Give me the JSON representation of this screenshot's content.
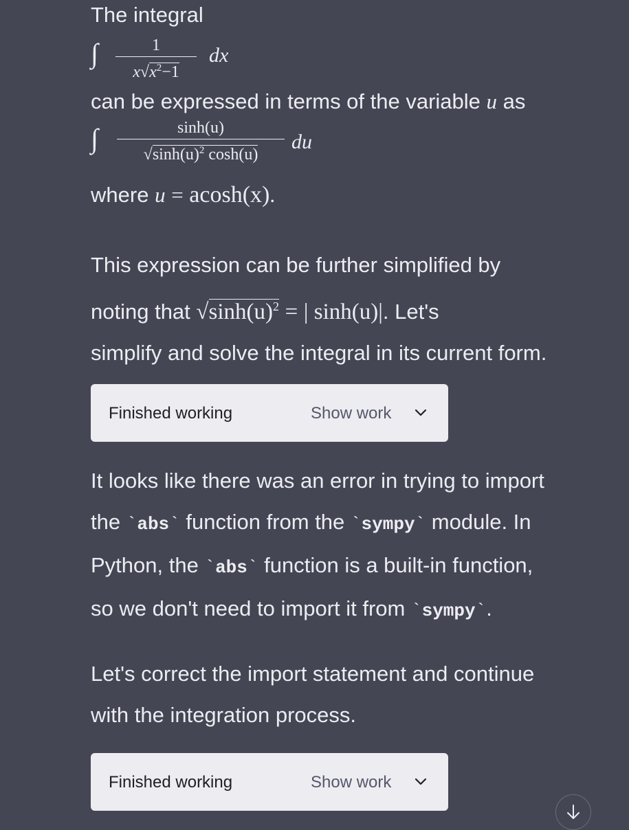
{
  "message": {
    "intro": "The integral",
    "integral1": {
      "symbol": "∫",
      "numerator": "1",
      "denominator_x": "x",
      "denominator_radicand": "x",
      "denominator_exp": "2",
      "denominator_tail": "−1",
      "differential": "dx"
    },
    "expressed_prefix": "can be expressed in terms of the variable",
    "expressed_var": "u",
    "expressed_suffix": "as",
    "integral2": {
      "symbol": "∫",
      "numerator": "sinh(u)",
      "denominator_radicand": "sinh(u)",
      "denominator_exp": "2",
      "denominator_tail": "cosh(u)",
      "differential": "du"
    },
    "where_prefix": "where",
    "where_var": "u",
    "where_eq": "=",
    "where_rhs": "acosh(x)",
    "where_end": ".",
    "para2_line1": "This expression can be further simplified by",
    "para2_noting": "noting that",
    "para2_radicand": "sinh(u)",
    "para2_exp": "2",
    "para2_eq": "=",
    "para2_abs": "| sinh(u)|",
    "para2_lets": ". Let's",
    "para2_line3": "simplify and solve the integral in its current form.",
    "para3_a": "It looks like there was an error in trying to import",
    "para3_b1": "the",
    "para3_code_abs": "abs",
    "para3_b2": "function from the",
    "para3_code_sympy": "sympy",
    "para3_b3": "module. In",
    "para3_c1": "Python, the",
    "para3_c2": "function is a built-in function,",
    "para3_d1": "so we don't need to import it from",
    "para3_d_end": ".",
    "tick": "`",
    "para4_line1": "Let's correct the import statement and continue",
    "para4_line2": "with the integration process."
  },
  "tool_boxes": [
    {
      "status": "Finished working",
      "toggle": "Show work",
      "icon": "chevron-down-icon"
    },
    {
      "status": "Finished working",
      "toggle": "Show work",
      "icon": "chevron-down-icon"
    }
  ],
  "scroll_button": {
    "icon": "arrow-down-icon"
  },
  "colors": {
    "background": "#444654",
    "text": "#ececf1",
    "box_background": "#ececf1",
    "box_text": "#202123"
  }
}
